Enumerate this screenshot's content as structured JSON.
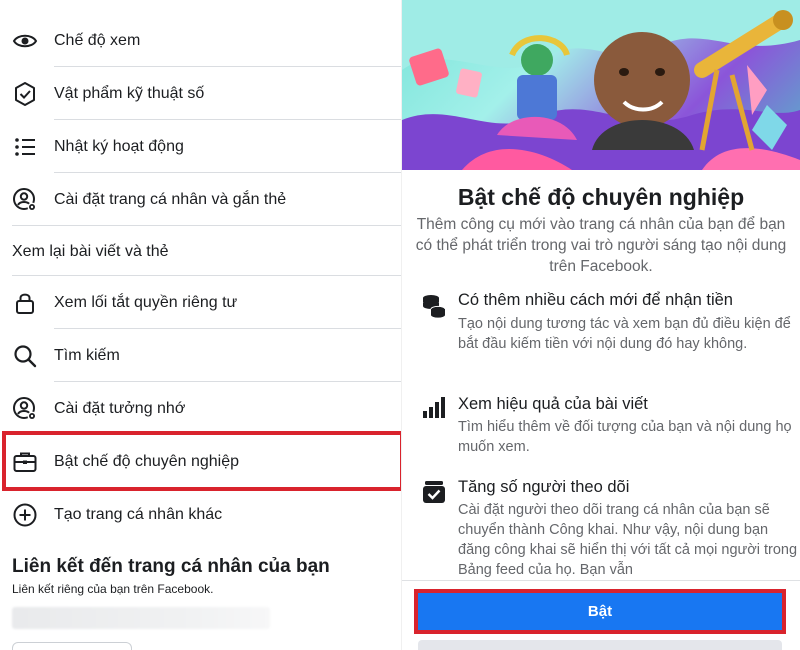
{
  "left_menu": {
    "items": [
      {
        "label": "Chế độ xem",
        "icon": "eye-icon"
      },
      {
        "label": "Vật phẩm kỹ thuật số",
        "icon": "badge-check-icon"
      },
      {
        "label": "Nhật ký hoạt động",
        "icon": "list-icon"
      },
      {
        "label": "Cài đặt trang cá nhân và gắn thẻ",
        "icon": "profile-settings-icon"
      },
      {
        "label": "Xem lại bài viết và thẻ",
        "icon": ""
      },
      {
        "label": "Xem lối tắt quyền riêng tư",
        "icon": "lock-icon"
      },
      {
        "label": "Tìm kiếm",
        "icon": "search-icon"
      },
      {
        "label": "Cài đặt tưởng nhớ",
        "icon": "profile-settings-icon"
      },
      {
        "label": "Bật chế độ chuyên nghiệp",
        "icon": "briefcase-icon"
      },
      {
        "label": "Tạo trang cá nhân khác",
        "icon": "plus-circle-icon"
      }
    ]
  },
  "profile_link": {
    "title": "Liên kết đến trang cá nhân của bạn",
    "subtitle": "Liên kết riêng của bạn trên Facebook."
  },
  "professional_mode": {
    "headline": "Bật chế độ chuyên nghiệp",
    "intro": "Thêm công cụ mới vào trang cá nhân của bạn để bạn có thể phát triển trong vai trò người sáng tạo nội dung trên Facebook.",
    "features": [
      {
        "icon": "coins-icon",
        "title": "Có thêm nhiều cách mới để nhận tiền",
        "desc": "Tạo nội dung tương tác và xem bạn đủ điều kiện để bắt đầu kiếm tiền với nội dung đó hay không."
      },
      {
        "icon": "bar-chart-icon",
        "title": "Xem hiệu quả của bài viết",
        "desc": "Tìm hiểu thêm về đối tượng của bạn và nội dung họ muốn xem."
      },
      {
        "icon": "inbox-check-icon",
        "title": "Tăng số người theo dõi",
        "desc": "Cài đặt người theo dõi trang cá nhân của bạn sẽ chuyển thành Công khai. Như vậy, nội dung bạn đăng công khai sẽ hiển thị với tất cả mọi người trong Bảng feed của họ. Bạn vẫn"
      }
    ],
    "cta_label": "Bật"
  },
  "colors": {
    "highlight": "#d9232d",
    "primary": "#1877f2",
    "secondary_text": "#65676b"
  }
}
